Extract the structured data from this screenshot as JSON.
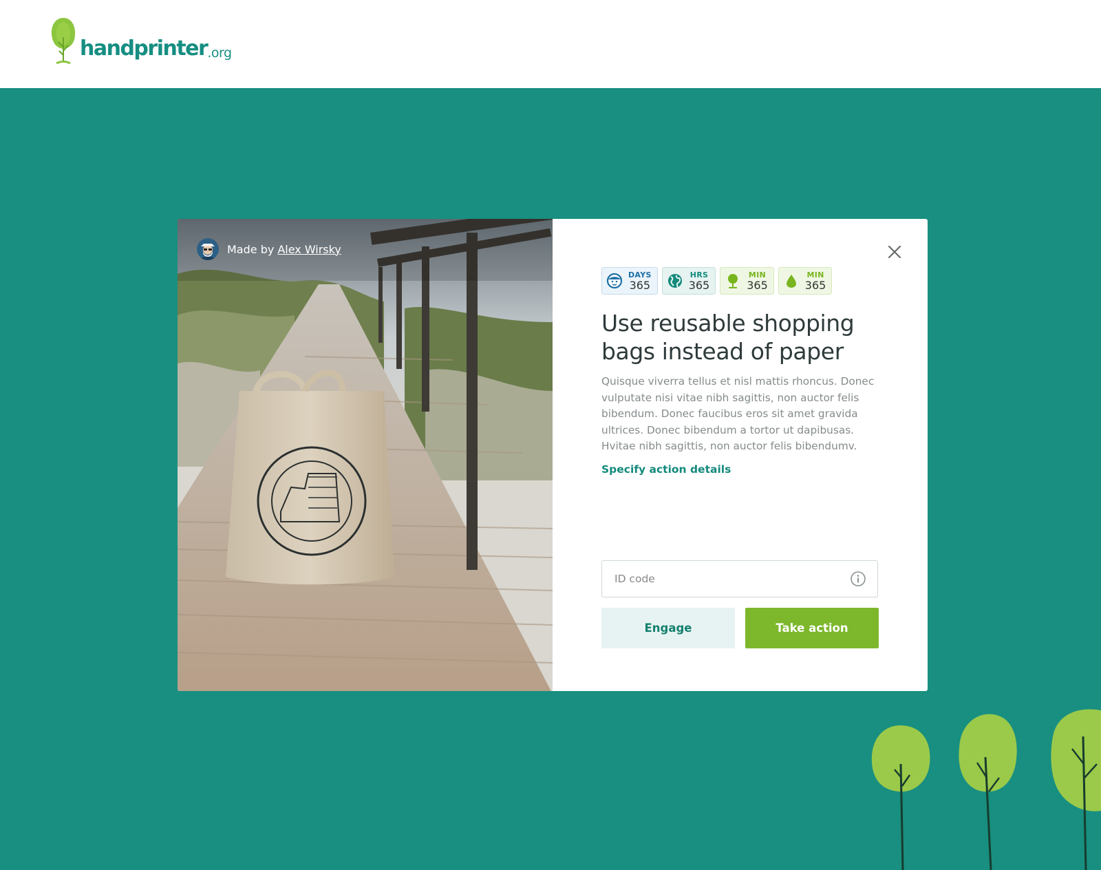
{
  "brand": {
    "name": "handprinter",
    "suffix": ".org"
  },
  "credit": {
    "prefix": "Made by",
    "author": "Alex Wirsky"
  },
  "stats": [
    {
      "icon": "face-icon",
      "unit": "DAYS",
      "value": "365",
      "tone": "blue"
    },
    {
      "icon": "globe-icon",
      "unit": "HRS",
      "value": "365",
      "tone": "teal"
    },
    {
      "icon": "tree-icon",
      "unit": "MIN",
      "value": "365",
      "tone": "green"
    },
    {
      "icon": "water-drop-icon",
      "unit": "MIN",
      "value": "365",
      "tone": "green"
    }
  ],
  "action": {
    "title": "Use reusable shopping bags instead of paper",
    "description": "Quisque viverra tellus et nisl mattis rhoncus. Donec vulputate nisi vitae nibh sagittis, non auctor felis bibendum. Donec faucibus eros sit amet gravida ultrices. Donec bibendum a tortor ut dapibusas. Hvitae nibh sagittis, non auctor felis bibendumv.",
    "details_link": "Specify action details"
  },
  "id_field": {
    "placeholder": "ID code",
    "value": ""
  },
  "buttons": {
    "engage": "Engage",
    "take_action": "Take action"
  },
  "colors": {
    "brand_teal": "#188f80",
    "accent_green": "#7db72c",
    "link_teal": "#138a7c"
  }
}
